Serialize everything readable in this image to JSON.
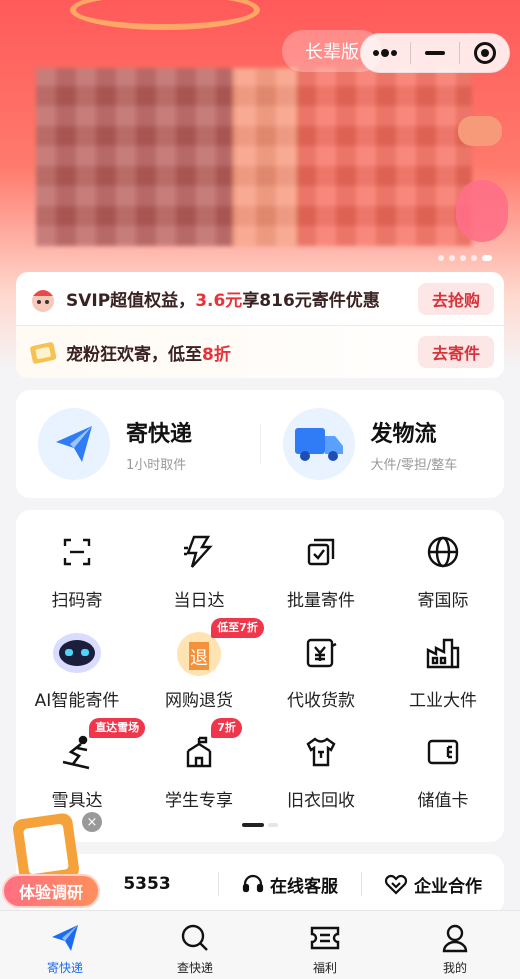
{
  "header": {
    "elder_mode_label": "长辈版"
  },
  "banner": {
    "slides_total": 5,
    "active_slide": 5
  },
  "promos": [
    {
      "icon": "mascot-icon",
      "text_prefix": "SVIP超值权益，",
      "text_highlight": "3.6元",
      "text_suffix": "享816元寄件优惠",
      "button": "去抢购"
    },
    {
      "icon": "coupon-icon",
      "text_prefix": "宠粉狂欢寄，低至",
      "text_highlight": "8折",
      "text_suffix": "",
      "button": "去寄件"
    }
  ],
  "main_services": [
    {
      "icon": "paper-plane-icon",
      "title": "寄快递",
      "subtitle": "1小时取件"
    },
    {
      "icon": "truck-icon",
      "title": "发物流",
      "subtitle": "大件/零担/整车"
    }
  ],
  "grid_items": [
    {
      "icon": "scan-icon",
      "label": "扫码寄",
      "badge": ""
    },
    {
      "icon": "lightning-icon",
      "label": "当日达",
      "badge": ""
    },
    {
      "icon": "batch-icon",
      "label": "批量寄件",
      "badge": ""
    },
    {
      "icon": "globe-icon",
      "label": "寄国际",
      "badge": ""
    },
    {
      "icon": "robot-icon",
      "label": "AI智能寄件",
      "badge": ""
    },
    {
      "icon": "return-icon",
      "label": "网购退货",
      "badge": "低至7折"
    },
    {
      "icon": "cash-icon",
      "label": "代收货款",
      "badge": ""
    },
    {
      "icon": "factory-icon",
      "label": "工业大件",
      "badge": ""
    },
    {
      "icon": "skier-icon",
      "label": "雪具达",
      "badge": "直达雪场"
    },
    {
      "icon": "school-icon",
      "label": "学生专享",
      "badge": "7折"
    },
    {
      "icon": "shirt-icon",
      "label": "旧衣回收",
      "badge": ""
    },
    {
      "icon": "card-icon",
      "label": "储值卡",
      "badge": ""
    }
  ],
  "support": {
    "hotline_partial": "5353",
    "online_service": "在线客服",
    "business": "企业合作"
  },
  "float_survey": {
    "label": "体验调研",
    "close": "×"
  },
  "tabs": [
    {
      "icon": "paper-plane-icon",
      "label": "寄快递",
      "active": true
    },
    {
      "icon": "search-icon",
      "label": "查快递",
      "active": false
    },
    {
      "icon": "ticket-icon",
      "label": "福利",
      "active": false
    },
    {
      "icon": "user-icon",
      "label": "我的",
      "active": false
    }
  ],
  "colors": {
    "accent_blue": "#1a6cf0",
    "promo_red": "#e7323a",
    "badge_red": "#f0364a"
  }
}
